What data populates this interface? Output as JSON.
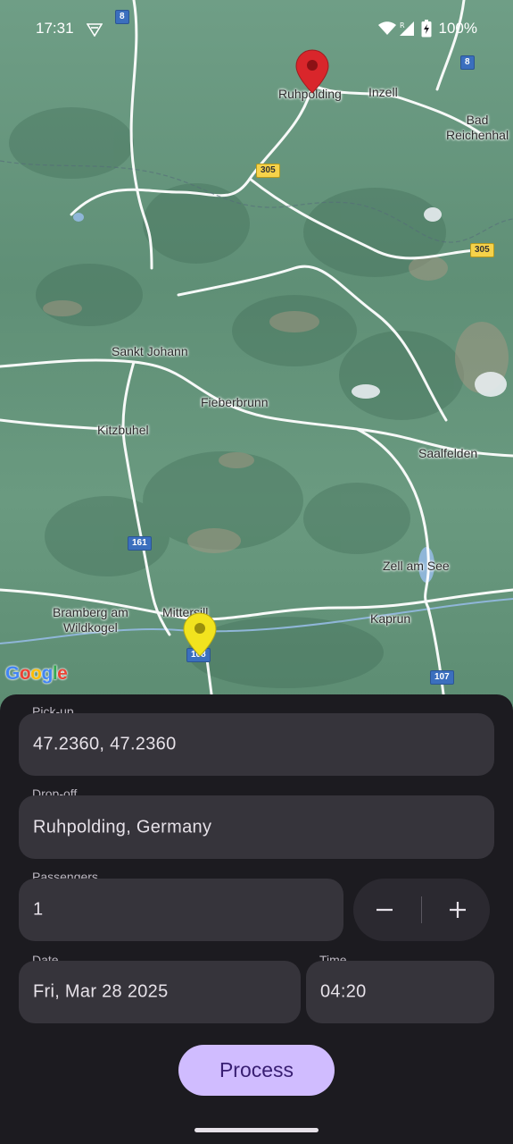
{
  "status_bar": {
    "time": "17:31",
    "battery": "100%"
  },
  "map": {
    "places": [
      {
        "id": "ruhpolding",
        "name": "Ruhpolding"
      },
      {
        "id": "inzell",
        "name": "Inzell"
      },
      {
        "id": "bad-reichenhall",
        "name": "Bad\nReichenhal"
      },
      {
        "id": "sankt-johann",
        "name": "Sankt Johann"
      },
      {
        "id": "fieberbrunn",
        "name": "Fieberbrunn"
      },
      {
        "id": "kitzbuhel",
        "name": "Kitzbuhel"
      },
      {
        "id": "saalfelden",
        "name": "Saalfelden"
      },
      {
        "id": "zell-am-see",
        "name": "Zell am See"
      },
      {
        "id": "bramberg",
        "name": "Bramberg am\nWildkogel"
      },
      {
        "id": "mittersill",
        "name": "Mittersill"
      },
      {
        "id": "kaprun",
        "name": "Kaprun"
      }
    ],
    "road_shields": [
      "8",
      "8",
      "305",
      "305",
      "161",
      "108",
      "107"
    ],
    "attribution": "Google"
  },
  "form": {
    "pickup": {
      "label": "Pick-up",
      "value": "47.2360, 47.2360"
    },
    "dropoff": {
      "label": "Drop-off",
      "value": "Ruhpolding, Germany"
    },
    "passengers": {
      "label": "Passengers",
      "value": "1",
      "decrement": "−",
      "increment": "+"
    },
    "date": {
      "label": "Date",
      "value": "Fri, Mar 28 2025"
    },
    "time": {
      "label": "Time",
      "value": "04:20"
    },
    "submit_label": "Process"
  },
  "colors": {
    "accent": "#d0bcff",
    "pin_destination": "#d9262b",
    "pin_pickup": "#f2e31e"
  }
}
